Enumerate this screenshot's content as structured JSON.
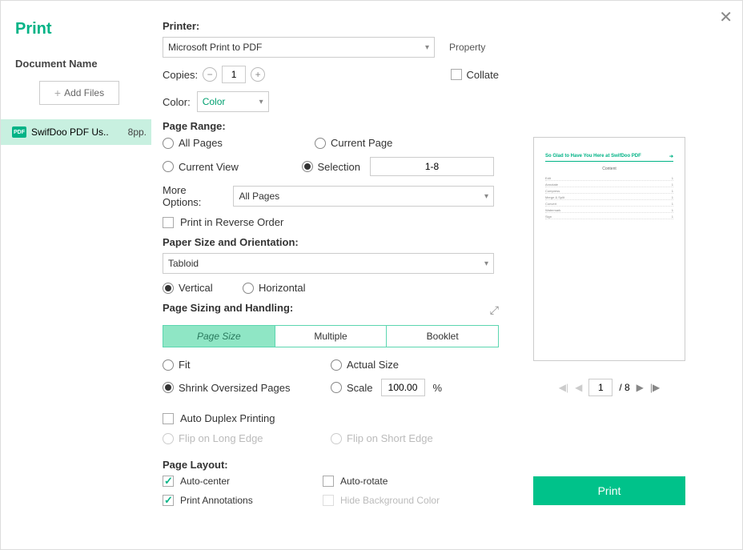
{
  "title": "Print",
  "close": "✕",
  "leftPanel": {
    "docNameLabel": "Document Name",
    "addFiles": "Add Files",
    "file": {
      "name": "SwifDoo PDF Us..",
      "pages": "8pp."
    }
  },
  "printer": {
    "label": "Printer:",
    "value": "Microsoft Print to PDF",
    "propertyLabel": "Property"
  },
  "copies": {
    "label": "Copies:",
    "value": "1"
  },
  "collate": "Collate",
  "color": {
    "label": "Color:",
    "value": "Color"
  },
  "pageRange": {
    "label": "Page Range:",
    "allPages": "All Pages",
    "currentPage": "Current Page",
    "currentView": "Current View",
    "selection": "Selection",
    "selectionValue": "1-8",
    "moreOptionsLabel": "More Options:",
    "moreOptionsValue": "All Pages",
    "reverseOrder": "Print in Reverse Order"
  },
  "paperSize": {
    "label": "Paper Size and Orientation:",
    "value": "Tabloid",
    "vertical": "Vertical",
    "horizontal": "Horizontal"
  },
  "sizing": {
    "label": "Page Sizing and Handling:",
    "tabs": [
      "Page Size",
      "Multiple",
      "Booklet"
    ],
    "fit": "Fit",
    "actual": "Actual Size",
    "shrink": "Shrink Oversized Pages",
    "scale": "Scale",
    "scaleValue": "100.00",
    "scaleUnit": "%"
  },
  "duplex": {
    "auto": "Auto Duplex Printing",
    "long": "Flip on Long Edge",
    "short": "Flip on Short Edge"
  },
  "layout": {
    "label": "Page Layout:",
    "autoCenter": "Auto-center",
    "autoRotate": "Auto-rotate",
    "annotations": "Print Annotations",
    "hideBg": "Hide Background Color"
  },
  "preview": {
    "title": "So Glad to Have You Here at SwifDoo PDF",
    "subtitle": "Content",
    "lines": [
      "Edit",
      "Annotate",
      "Compress",
      "Merge & Split",
      "Convert",
      "Watermark",
      "Sign"
    ]
  },
  "pager": {
    "page": "1",
    "total": "/ 8"
  },
  "printBtn": "Print"
}
